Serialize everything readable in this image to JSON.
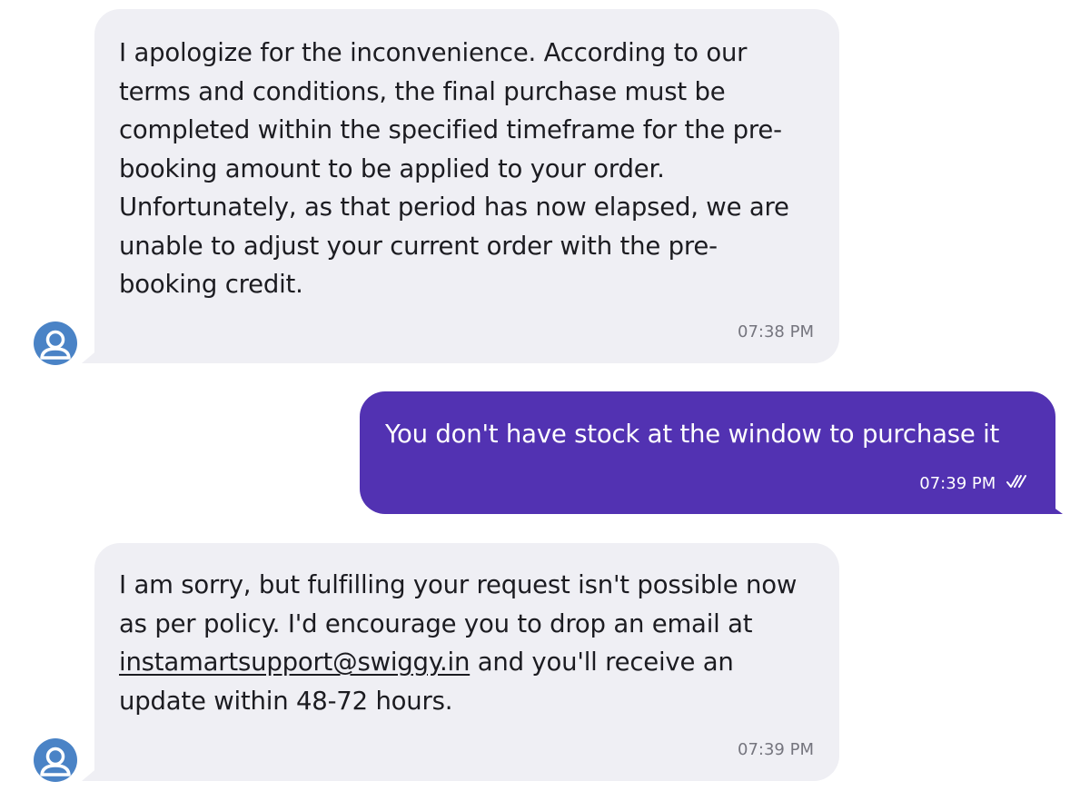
{
  "messages": [
    {
      "sender": "agent",
      "text": "I apologize for the inconvenience. According to our terms and conditions, the final purchase must be completed within the specified timeframe for the pre-booking amount to be applied to your order. Unfortunately, as that period has now elapsed, we are unable to adjust your current order with the pre-booking credit.",
      "time": "07:38 PM",
      "avatar_icon": "user-avatar-icon"
    },
    {
      "sender": "user",
      "text": "You don't have stock at the window to purchase it",
      "time": "07:39 PM",
      "status_icon": "double-check-icon"
    },
    {
      "sender": "agent",
      "text_before_link": "I am sorry, but fulfilling your request isn't possible now as per policy. I'd encourage you to drop an email at",
      "link": "instamartsupport@swiggy.in",
      "text_after_link": "and you'll receive an update within 48-72 hours.",
      "time": "07:39 PM",
      "avatar_icon": "user-avatar-icon"
    }
  ],
  "colors": {
    "agent_bubble": "#efeff4",
    "user_bubble": "#5232b2",
    "avatar": "#4a83c6",
    "timestamp": "#75757e"
  }
}
